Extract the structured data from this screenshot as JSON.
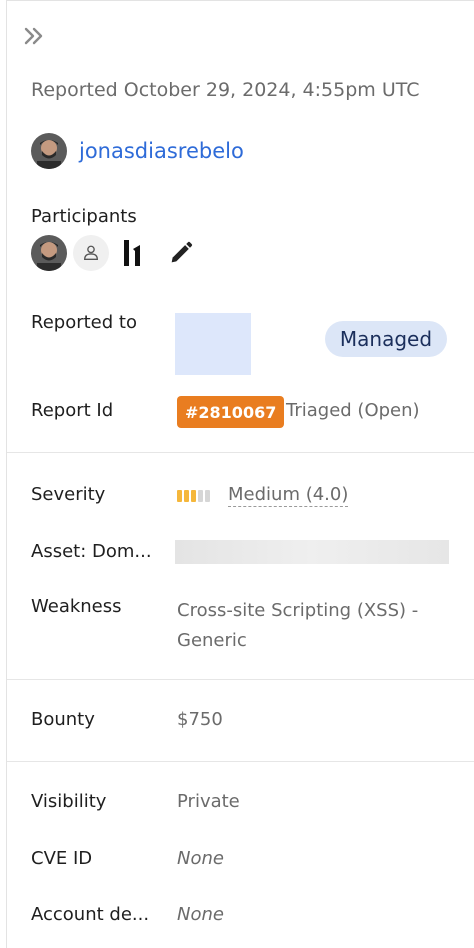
{
  "reported": {
    "text": "Reported October 29, 2024, 4:55pm UTC"
  },
  "reporter": {
    "username": "jonasdiasrebelo"
  },
  "participants": {
    "label": "Participants"
  },
  "reported_to": {
    "label": "Reported to",
    "badge": "Managed"
  },
  "report_id": {
    "label": "Report Id",
    "id": "#2810067",
    "state": "Triaged (Open)"
  },
  "severity": {
    "label": "Severity",
    "value": "Medium (4.0)",
    "level": 3,
    "max_level": 5,
    "active_color": "#f5b73b",
    "inactive_color": "#d6d6d6"
  },
  "asset": {
    "label": "Asset: Dom..."
  },
  "weakness": {
    "label": "Weakness",
    "value": "Cross-site Scripting (XSS) - Generic"
  },
  "bounty": {
    "label": "Bounty",
    "value": "$750"
  },
  "visibility": {
    "label": "Visibility",
    "value": "Private"
  },
  "cve": {
    "label": "CVE ID",
    "value": "None"
  },
  "account": {
    "label": "Account de...",
    "value": "None"
  },
  "colors": {
    "link": "#2e6bd8",
    "badge_orange": "#e97d20",
    "managed_bg": "#dce6f7"
  }
}
